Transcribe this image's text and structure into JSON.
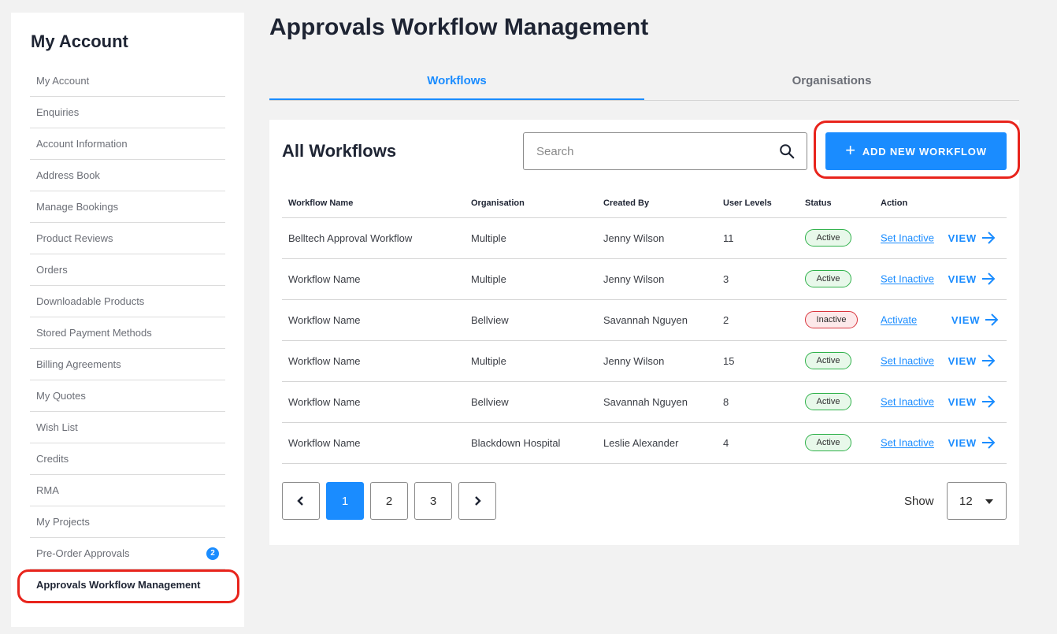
{
  "sidebar": {
    "title": "My Account",
    "items": [
      {
        "label": "My Account"
      },
      {
        "label": "Enquiries"
      },
      {
        "label": "Account Information"
      },
      {
        "label": "Address Book"
      },
      {
        "label": "Manage Bookings"
      },
      {
        "label": "Product Reviews"
      },
      {
        "label": "Orders"
      },
      {
        "label": "Downloadable Products"
      },
      {
        "label": "Stored Payment Methods"
      },
      {
        "label": "Billing Agreements"
      },
      {
        "label": "My Quotes"
      },
      {
        "label": "Wish List"
      },
      {
        "label": "Credits"
      },
      {
        "label": "RMA"
      },
      {
        "label": "My Projects"
      },
      {
        "label": "Pre-Order Approvals",
        "badge": "2"
      },
      {
        "label": "Approvals Workflow Management",
        "active": true
      }
    ]
  },
  "page": {
    "title": "Approvals Workflow Management"
  },
  "tabs": [
    {
      "label": "Workflows",
      "active": true
    },
    {
      "label": "Organisations"
    }
  ],
  "panel": {
    "title": "All Workflows",
    "search": {
      "placeholder": "Search",
      "value": "",
      "icon": "search-icon"
    },
    "add_button": {
      "label": "ADD NEW WORKFLOW",
      "icon": "plus-icon"
    }
  },
  "table": {
    "columns": [
      "Workflow Name",
      "Organisation",
      "Created By",
      "User Levels",
      "Status",
      "Action"
    ],
    "rows": [
      {
        "name": "Belltech Approval Workflow",
        "organisation": "Multiple",
        "created_by": "Jenny Wilson",
        "user_levels": "11",
        "status": "Active",
        "action": "Set Inactive",
        "view": "VIEW"
      },
      {
        "name": "Workflow Name",
        "organisation": "Multiple",
        "created_by": "Jenny Wilson",
        "user_levels": "3",
        "status": "Active",
        "action": "Set Inactive",
        "view": "VIEW"
      },
      {
        "name": "Workflow Name",
        "organisation": "Bellview",
        "created_by": "Savannah Nguyen",
        "user_levels": "2",
        "status": "Inactive",
        "action": "Activate",
        "view": "VIEW"
      },
      {
        "name": "Workflow Name",
        "organisation": "Multiple",
        "created_by": "Jenny Wilson",
        "user_levels": "15",
        "status": "Active",
        "action": "Set Inactive",
        "view": "VIEW"
      },
      {
        "name": "Workflow Name",
        "organisation": "Bellview",
        "created_by": "Savannah Nguyen",
        "user_levels": "8",
        "status": "Active",
        "action": "Set Inactive",
        "view": "VIEW"
      },
      {
        "name": "Workflow Name",
        "organisation": "Blackdown Hospital",
        "created_by": "Leslie Alexander",
        "user_levels": "4",
        "status": "Active",
        "action": "Set Inactive",
        "view": "VIEW"
      }
    ]
  },
  "pagination": {
    "pages": [
      "1",
      "2",
      "3"
    ],
    "current": "1",
    "show_label": "Show",
    "show_value": "12"
  },
  "colors": {
    "accent": "#1a8cff",
    "highlight": "#e8241c",
    "status_active": "#2fb14a",
    "status_inactive": "#d9363e"
  }
}
